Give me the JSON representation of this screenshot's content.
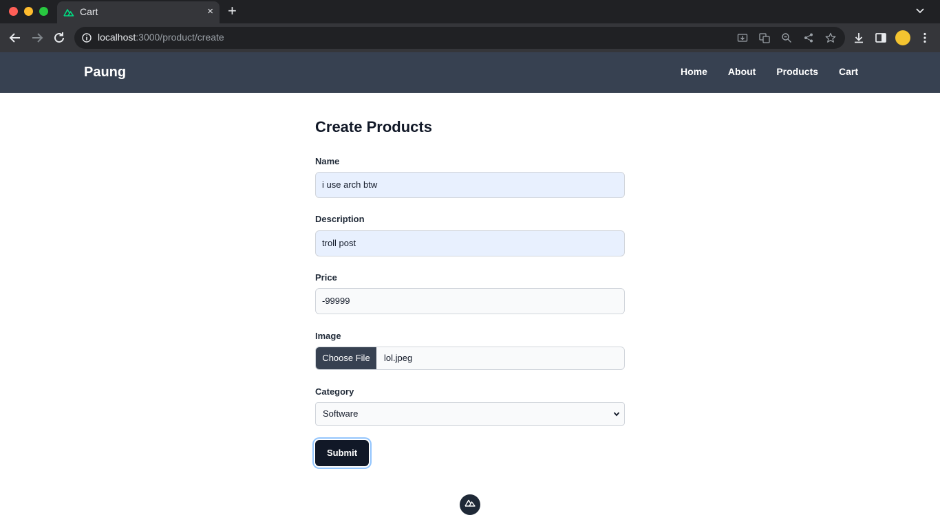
{
  "browser": {
    "tab_title": "Cart",
    "close_glyph": "×",
    "new_tab_glyph": "+",
    "url_host": "localhost",
    "url_rest": ":3000/product/create"
  },
  "site": {
    "brand": "Paung",
    "nav": [
      "Home",
      "About",
      "Products",
      "Cart"
    ]
  },
  "form": {
    "title": "Create Products",
    "name_label": "Name",
    "name_value": "i use arch btw",
    "description_label": "Description",
    "description_value": "troll post",
    "price_label": "Price",
    "price_value": "-99999",
    "image_label": "Image",
    "choose_file_label": "Choose File",
    "file_name": "lol.jpeg",
    "category_label": "Category",
    "category_selected": "Software",
    "submit_label": "Submit"
  },
  "colors": {
    "navbar": "#374151",
    "submit": "#111827",
    "autofill": "#e8f0fe",
    "tab_icon": "#00dc82"
  },
  "icons": [
    "nuxt-icon",
    "back-icon",
    "forward-icon",
    "reload-icon",
    "info-icon",
    "install-icon",
    "translate-icon",
    "zoom-icon",
    "share-icon",
    "star-icon",
    "download-icon",
    "side-panel-icon",
    "menu-icon"
  ]
}
